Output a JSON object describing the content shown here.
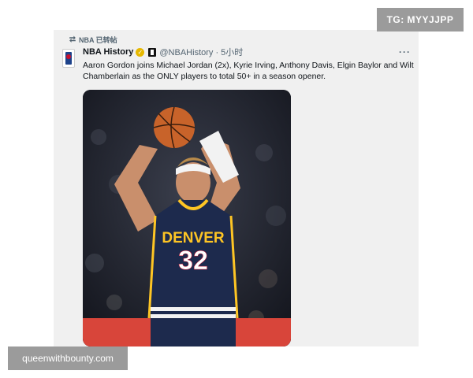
{
  "retweet": {
    "icon": "retweet-icon",
    "label": "NBA 已转帖"
  },
  "tweet": {
    "display_name": "NBA History",
    "verified_icon": "verified-badge-icon",
    "affiliate_icon": "nba-affiliate-badge-icon",
    "handle_time": "@NBAHistory · 5小时",
    "more_label": "···",
    "text": "Aaron Gordon joins Michael Jordan (2x), Kyrie Irving, Anthony Davis, Elgin Baylor and Wilt Chamberlain as the ONLY players to total 50+ in a season opener.",
    "media": {
      "jersey_team": "DENVER",
      "jersey_number": "32",
      "colors": {
        "jersey": "#1d2a4d",
        "jersey_trim": "#fec524",
        "ball": "#c8632a"
      }
    }
  },
  "watermarks": {
    "telegram": "TG: MYYJJPP",
    "site": "queenwithbounty.com"
  }
}
